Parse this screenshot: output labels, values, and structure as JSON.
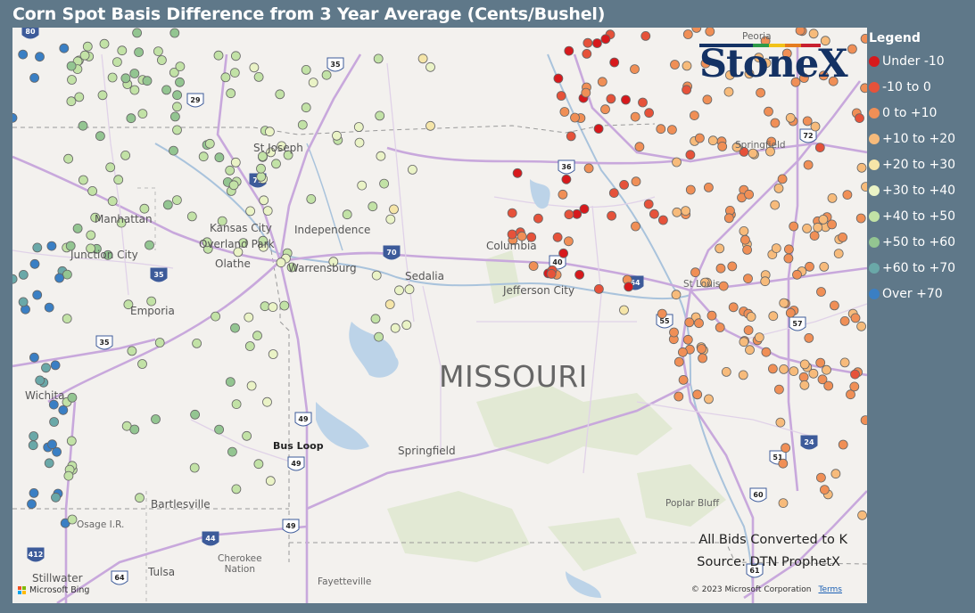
{
  "title": "Corn Spot Basis Difference from 3 Year Average (Cents/Bushel)",
  "legend": {
    "title": "Legend",
    "items": [
      {
        "label": "Under -10",
        "color": "#d7191c"
      },
      {
        "label": "-10 to 0",
        "color": "#e6523a"
      },
      {
        "label": "0 to +10",
        "color": "#f08f56"
      },
      {
        "label": "+10 to +20",
        "color": "#f7bb7b"
      },
      {
        "label": "+20 to +30",
        "color": "#f5e5a8"
      },
      {
        "label": "+30 to +40",
        "color": "#eaf3c6"
      },
      {
        "label": "+40 to +50",
        "color": "#c2e2a6"
      },
      {
        "label": "+50 to +60",
        "color": "#93c591"
      },
      {
        "label": "+60 to +70",
        "color": "#6aa8a8"
      },
      {
        "label": "Over +70",
        "color": "#3a7fc4"
      }
    ]
  },
  "logo": {
    "text": "StoneX"
  },
  "notes": {
    "line1": "All Bids Converted to K",
    "line2": "Source: DTN ProphetX"
  },
  "attribution": {
    "bing": "Microsoft Bing",
    "copyright": "© 2023 Microsoft Corporation",
    "terms": "Terms"
  },
  "state_label": "MISSOURI",
  "places": {
    "peoria": "Peoria",
    "st_joseph": "St Joseph",
    "kansas_city": "Kansas City",
    "overland_park": "Overland Park",
    "independence": "Independence",
    "manhattan": "Manhattan",
    "junction_city": "Junction City",
    "olathe": "Olathe",
    "warrensburg": "Warrensburg",
    "sedalia": "Sedalia",
    "columbia": "Columbia",
    "jefferson_city": "Jefferson City",
    "springfield_il": "Springfield",
    "st_louis": "St Louis",
    "emporia": "Emporia",
    "wichita": "Wichita",
    "bus_loop": "Bus Loop",
    "springfield": "Springfield",
    "bartlesville": "Bartlesville",
    "osage": "Osage I.R.",
    "cherokee": "Cherokee\nNation",
    "tulsa": "Tulsa",
    "stillwater": "Stillwater",
    "fayetteville": "Fayetteville",
    "poplar_bluff": "Poplar Bluff"
  },
  "shields": [
    "80",
    "35",
    "29",
    "71",
    "36",
    "72",
    "70",
    "35",
    "40",
    "64",
    "55",
    "57",
    "35",
    "49",
    "49",
    "24",
    "51",
    "60",
    "44",
    "49",
    "64",
    "412",
    "61"
  ]
}
